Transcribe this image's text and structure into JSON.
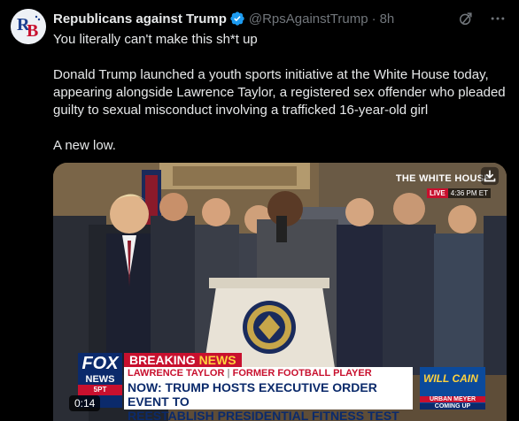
{
  "tweet": {
    "author_name": "Republicans against Trump",
    "handle": "@RpsAgainstTrump",
    "separator": "·",
    "time": "8h",
    "avatar_text": "RB",
    "lines": [
      "You literally can't make this sh*t up",
      "Donald Trump launched a youth sports initiative at the White House today, appearing alongside Lawrence Taylor, a registered sex offender who pleaded guilty to sexual misconduct involving a trafficked 16-year-old girl",
      "A new low."
    ]
  },
  "video": {
    "network_bug_title": "THE WHITE HOUSE",
    "live_label": "LIVE",
    "clock": "4:36 PM ET",
    "breaking_label": "BREAKING",
    "news_label": "NEWS",
    "name_strip_name": "LAWRENCE TAYLOR",
    "name_strip_divider": "|",
    "name_strip_role": "FORMER FOOTBALL PLAYER",
    "headline_line1": "NOW: TRUMP HOSTS EXECUTIVE ORDER EVENT TO",
    "headline_line2": "REESTABLISH PRESIDENTIAL FITNESS TEST IN SCHOOLS",
    "logo_line1": "FOX",
    "logo_line2": "NEWS",
    "logo_line3": "5PT",
    "inset_show": "WILL CAIN",
    "inset_line1": "URBAN MEYER",
    "inset_line2": "COMING UP",
    "elapsed": "0:14"
  },
  "colors": {
    "background": "#000000",
    "text": "#e7e9ea",
    "muted": "#71767b",
    "verified": "#1d9bf0",
    "fox_red": "#c8102e",
    "fox_blue": "#0b2a6b"
  }
}
